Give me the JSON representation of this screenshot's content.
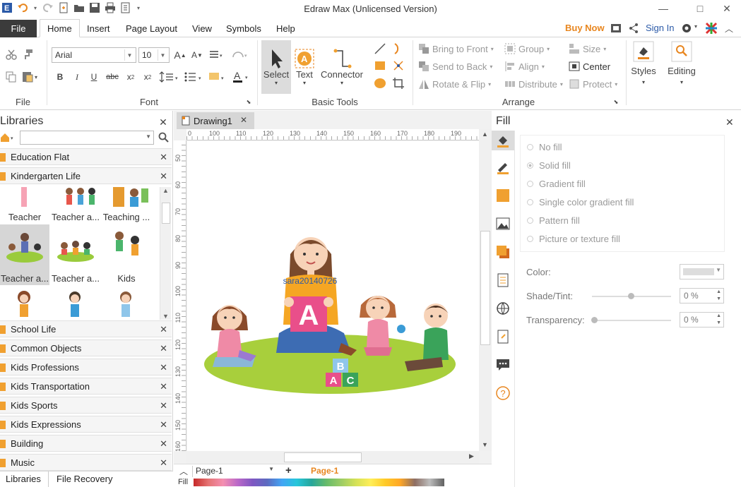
{
  "window": {
    "title": "Edraw Max (Unlicensed Version)",
    "minimize": "—",
    "maximize": "□",
    "close": "✕"
  },
  "tabs": {
    "file": "File",
    "items": [
      "Home",
      "Insert",
      "Page Layout",
      "View",
      "Symbols",
      "Help"
    ],
    "active": "Home",
    "buy_now": "Buy Now",
    "sign_in": "Sign In"
  },
  "ribbon": {
    "font_name": "Arial",
    "font_size": "10",
    "groups": {
      "file": "File",
      "font": "Font",
      "basic_tools": "Basic Tools",
      "arrange": "Arrange"
    },
    "select": "Select",
    "text": "Text",
    "connector": "Connector",
    "arrange": {
      "bring_front": "Bring to Front",
      "send_back": "Send to Back",
      "rotate_flip": "Rotate & Flip",
      "group": "Group",
      "align": "Align",
      "distribute": "Distribute",
      "size": "Size",
      "center": "Center",
      "protect": "Protect"
    },
    "styles": "Styles",
    "editing": "Editing"
  },
  "libraries": {
    "title": "Libraries",
    "categories_top": [
      "Education Flat",
      "Kindergarten Life"
    ],
    "items": [
      {
        "label": "Teacher"
      },
      {
        "label": "Teacher a..."
      },
      {
        "label": "Teaching ..."
      },
      {
        "label": "Teacher a..."
      },
      {
        "label": "Teacher a..."
      },
      {
        "label": "Kids"
      }
    ],
    "categories_bottom": [
      "School Life",
      "Common Objects",
      "Kids Professions",
      "Kids Transportation",
      "Kids Sports",
      "Kids Expressions",
      "Building",
      "Music"
    ],
    "bottom_tabs": [
      "Libraries",
      "File Recovery"
    ]
  },
  "document": {
    "tab": "Drawing1",
    "ruler_h": [
      "0",
      "100",
      "110",
      "120",
      "130",
      "140",
      "150",
      "160",
      "170",
      "180",
      "190"
    ],
    "ruler_v": [
      "50",
      "60",
      "70",
      "80",
      "90",
      "100",
      "110",
      "120",
      "130",
      "140",
      "150",
      "160"
    ],
    "watermark": "sara20140726",
    "block_letters": [
      "A",
      "B",
      "A",
      "C"
    ],
    "page_select": "Page-1",
    "page_tab": "Page-1",
    "fill_label": "Fill"
  },
  "fill": {
    "title": "Fill",
    "options": [
      "No fill",
      "Solid fill",
      "Gradient fill",
      "Single color gradient fill",
      "Pattern fill",
      "Picture or texture fill"
    ],
    "selected": "Solid fill",
    "color_label": "Color:",
    "shade_label": "Shade/Tint:",
    "shade_value": "0 %",
    "transparency_label": "Transparency:",
    "transparency_value": "0 %"
  },
  "colors": {
    "accent": "#e8861f",
    "file_tab": "#3b3b3b",
    "link": "#2b5aa8"
  }
}
